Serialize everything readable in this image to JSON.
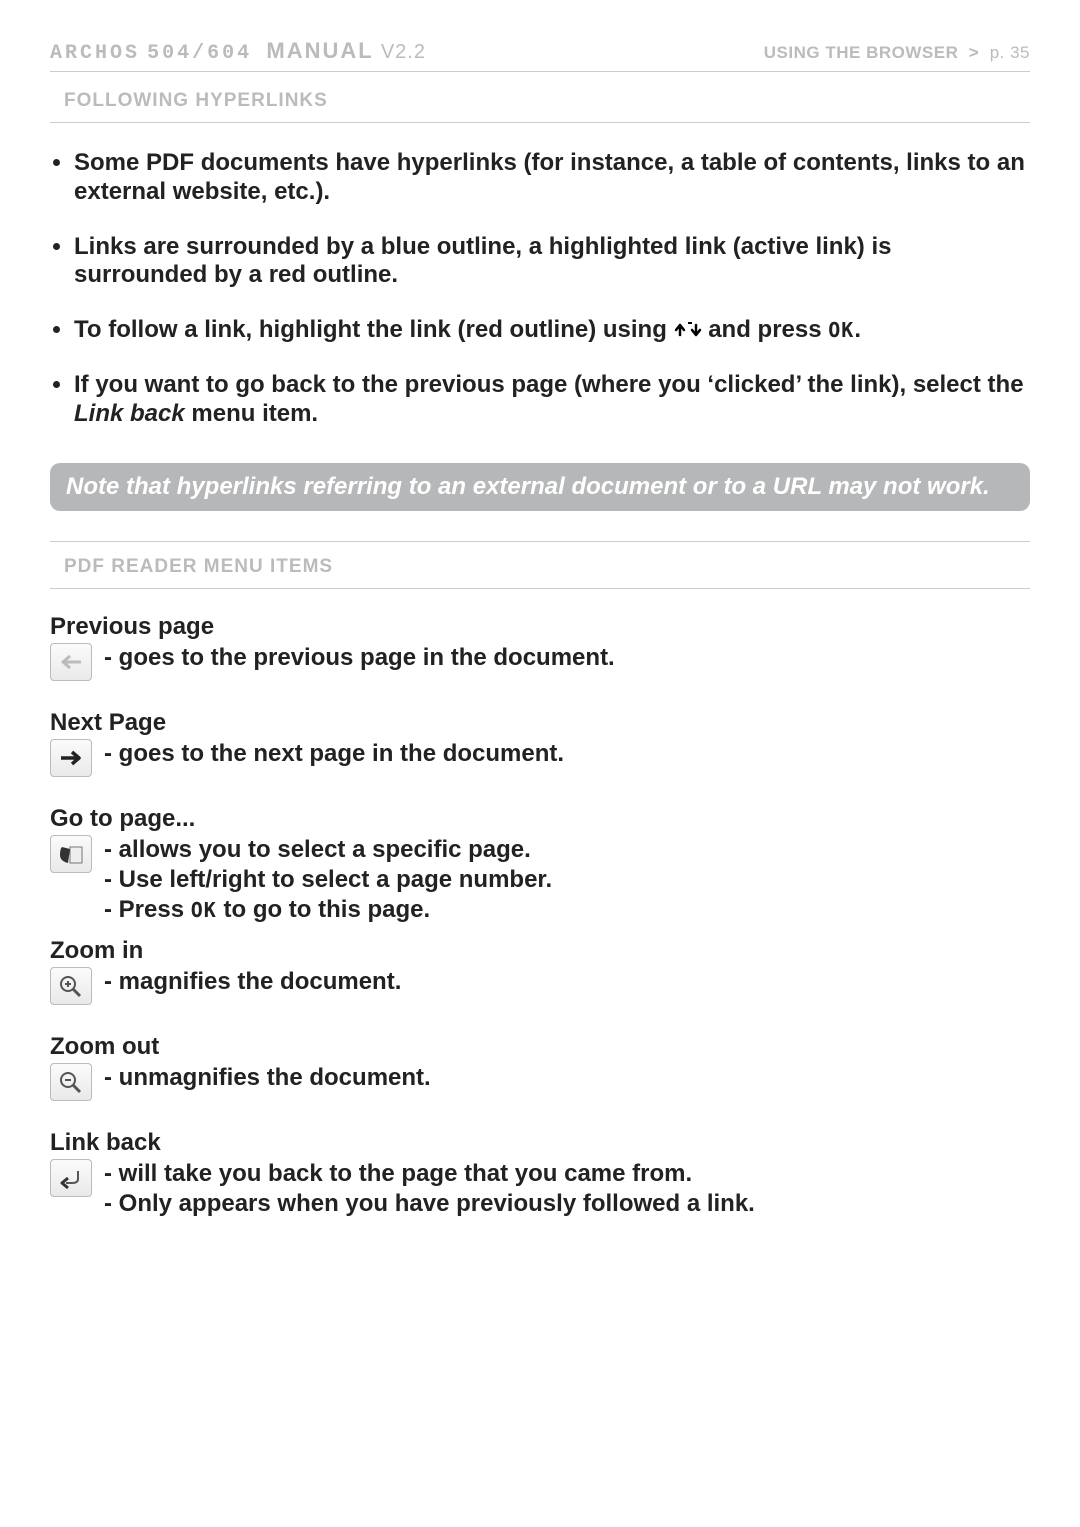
{
  "header": {
    "brand": "ARCHOS",
    "model": "504/604",
    "manual": "MANUAL",
    "version": "V2.2",
    "section": "USING THE BROWSER",
    "page": "p. 35"
  },
  "section1_title": "FOLLOWING HYPERLINKS",
  "bullets": [
    {
      "text_before": "Some PDF documents have hyperlinks (for instance, a table of contents, links to an external website, etc.).",
      "has_arrows": false,
      "has_ok": false
    },
    {
      "text_before": "Links are surrounded by a blue outline, a highlighted link (active link) is surrounded by a red outline.",
      "has_arrows": false,
      "has_ok": false
    },
    {
      "text_before": "To follow a link, highlight the link (red outline) using ",
      "text_after": " and press ",
      "has_arrows": true,
      "has_ok": true,
      "tail": "."
    },
    {
      "text_before": "If you want to go back to the previous page (where you ‘clicked’ the link), select the ",
      "link_back": "Link back",
      "tail": " menu item.",
      "has_arrows": false,
      "has_ok": false
    }
  ],
  "note": "Note that hyperlinks referring to an external document or to a URL may not work.",
  "section2_title": "PDF READER MENU ITEMS",
  "menu_items": [
    {
      "title": "Previous page",
      "icon": "arrow-left-faded",
      "lines": [
        "goes to the previous page in the document."
      ]
    },
    {
      "title": "Next Page",
      "icon": "arrow-right",
      "lines": [
        "goes to the next page in the document."
      ]
    },
    {
      "title": "Go to page...",
      "icon": "page-turn",
      "lines": [
        "allows you to select a specific page.",
        "Use left/right to select a page number.",
        "Press ␀OK␀ to go to this page."
      ]
    },
    {
      "title": "Zoom in",
      "icon": "zoom-in",
      "lines": [
        "magnifies the document."
      ]
    },
    {
      "title": "Zoom out",
      "icon": "zoom-out",
      "lines": [
        "unmagnifies the document."
      ]
    },
    {
      "title": "Link back",
      "icon": "link-back",
      "lines": [
        "will take you back to the page that you came from.",
        "Only appears when you have previously followed a link."
      ]
    }
  ],
  "ok_text": "OK"
}
